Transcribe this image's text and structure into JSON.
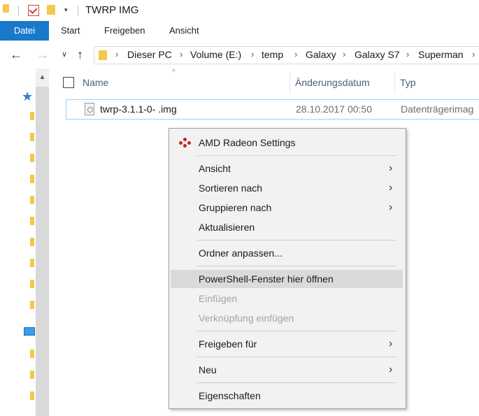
{
  "window": {
    "title": "TWRP IMG"
  },
  "ribbon": {
    "tabs": [
      "Datei",
      "Start",
      "Freigeben",
      "Ansicht"
    ]
  },
  "address": {
    "crumbs": [
      "Dieser PC",
      "Volume (E:)",
      "temp",
      "Galaxy",
      "Galaxy S7",
      "Superman"
    ]
  },
  "columns": {
    "name": "Name",
    "date": "Änderungsdatum",
    "type": "Typ"
  },
  "files": [
    {
      "name": "twrp-3.1.1-0- .img",
      "date": "28.10.2017 00:50",
      "type": "Datenträgerimag"
    }
  ],
  "menu": {
    "amd": "AMD Radeon Settings",
    "ansicht": "Ansicht",
    "sortieren": "Sortieren nach",
    "gruppieren": "Gruppieren nach",
    "aktualisieren": "Aktualisieren",
    "ordner_anpassen": "Ordner anpassen...",
    "powershell": "PowerShell-Fenster hier öffnen",
    "einfuegen": "Einfügen",
    "verknuepfung": "Verknüpfung einfügen",
    "freigeben": "Freigeben für",
    "neu": "Neu",
    "eigenschaften": "Eigenschaften"
  },
  "colors": {
    "accent": "#1979ca",
    "selection_border": "#99d1ff",
    "menu_bg": "#f2f2f2"
  }
}
